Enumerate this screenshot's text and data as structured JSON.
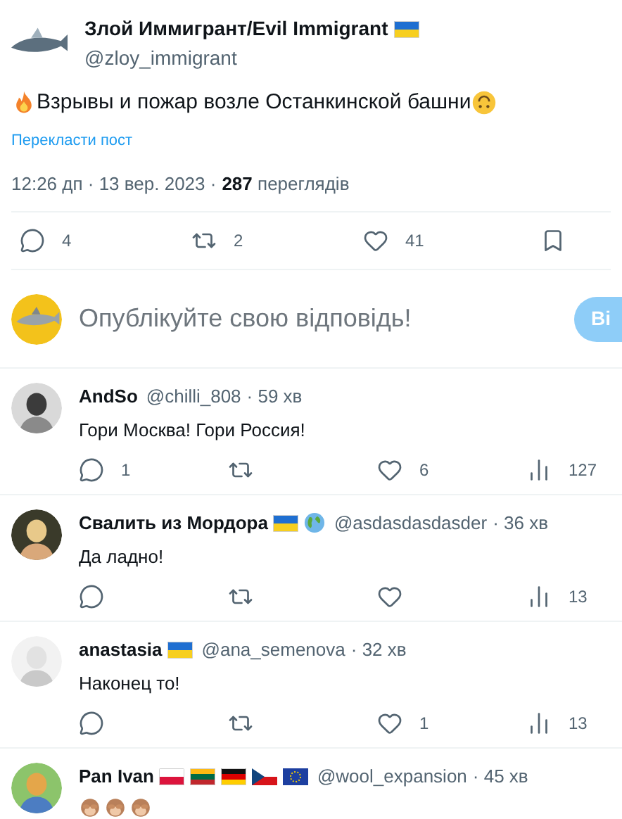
{
  "post": {
    "author": {
      "name": "Злой Иммигрант/Evil Immigrant",
      "flags": [
        {
          "kind": "ukraine"
        }
      ],
      "handle": "@zloy_immigrant"
    },
    "text": {
      "lead_emoji": {
        "kind": "fire"
      },
      "body": "Взрывы и пожар возле Останкинской башни",
      "trail_emoji": {
        "kind": "upside-down-face"
      }
    },
    "translate_link": "Перекласти пост",
    "meta": {
      "time": "12:26 дп · 13 вер. 2023 ·",
      "views": "287",
      "views_label": "переглядів"
    },
    "actions": {
      "replies": "4",
      "reposts": "2",
      "likes": "41"
    }
  },
  "composer": {
    "placeholder": "Опублікуйте свою відповідь!",
    "button": "Ві"
  },
  "replies": [
    {
      "name": "AndSo",
      "handle": "@chilli_808",
      "time": "· 59 хв",
      "text": "Гори Москва! Гори Россия!",
      "replies": "1",
      "likes": "6",
      "views": "127",
      "avatar": {
        "kind": "dark"
      }
    },
    {
      "name": "Свалить из Мордора",
      "flags": [
        {
          "kind": "ukraine"
        },
        {
          "kind": "globe"
        }
      ],
      "handle": "@asdasdasdasder",
      "time": "· 36 хв",
      "text": "Да ладно!",
      "views": "13",
      "avatar": {
        "kind": "blonde"
      }
    },
    {
      "name": "anastasia",
      "flags": [
        {
          "kind": "ukraine"
        }
      ],
      "handle": "@ana_semenova",
      "time": "· 32 хв",
      "text": "Наконец то!",
      "likes": "1",
      "views": "13",
      "avatar": {
        "kind": "light"
      }
    },
    {
      "name": "Pan Ivan",
      "flags": [
        {
          "kind": "poland"
        },
        {
          "kind": "lithuania"
        },
        {
          "kind": "germany"
        },
        {
          "kind": "czechia"
        },
        {
          "kind": "eu"
        }
      ],
      "handle": "@wool_expansion",
      "time": "· 45 хв",
      "emojis": [
        {
          "kind": "see-no-evil"
        },
        {
          "kind": "see-no-evil"
        },
        {
          "kind": "see-no-evil"
        }
      ],
      "avatar": {
        "kind": "colorful"
      }
    }
  ]
}
